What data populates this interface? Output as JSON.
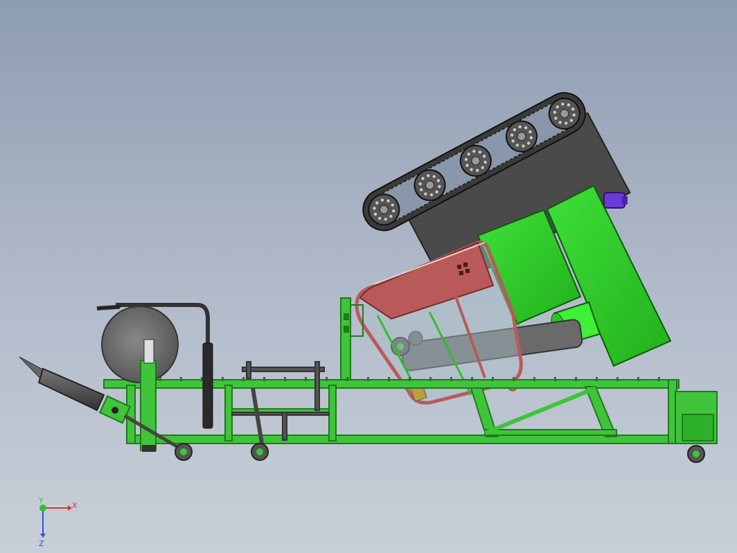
{
  "view": {
    "background_top": "#8e9cb1",
    "background_bottom": "#c9cfd8"
  },
  "colors": {
    "frame_green": "#3fc43a",
    "frame_dark_green": "#1f7a1c",
    "panel_green": "#2fd12a",
    "cab_red": "#b85a5a",
    "cab_dark_red": "#8e3a3a",
    "track_dark": "#2b2b2b",
    "hopper_dark": "#4a4a4a",
    "motor_purple": "#6a3bd6",
    "reel_gray": "#666666",
    "drill_gray": "#4b4b4b",
    "orange_cap": "#e07020"
  },
  "parts": {
    "track_assembly": "crawler-track",
    "sprockets": [
      "sprocket-1",
      "sprocket-2",
      "sprocket-3",
      "sprocket-4",
      "sprocket-5"
    ],
    "reel": "cable-reel",
    "drill_bit": "drill-cone",
    "cab": "operator-cab",
    "control_panels": [
      "panel-left",
      "panel-right"
    ],
    "wheels": [
      "wheel-front",
      "wheel-mid",
      "wheel-rear"
    ]
  },
  "triad": {
    "x_label": "X",
    "y_label": "Y",
    "z_label": "Z",
    "x_color": "#e03030",
    "y_color": "#30c030",
    "z_color": "#3050e0"
  }
}
